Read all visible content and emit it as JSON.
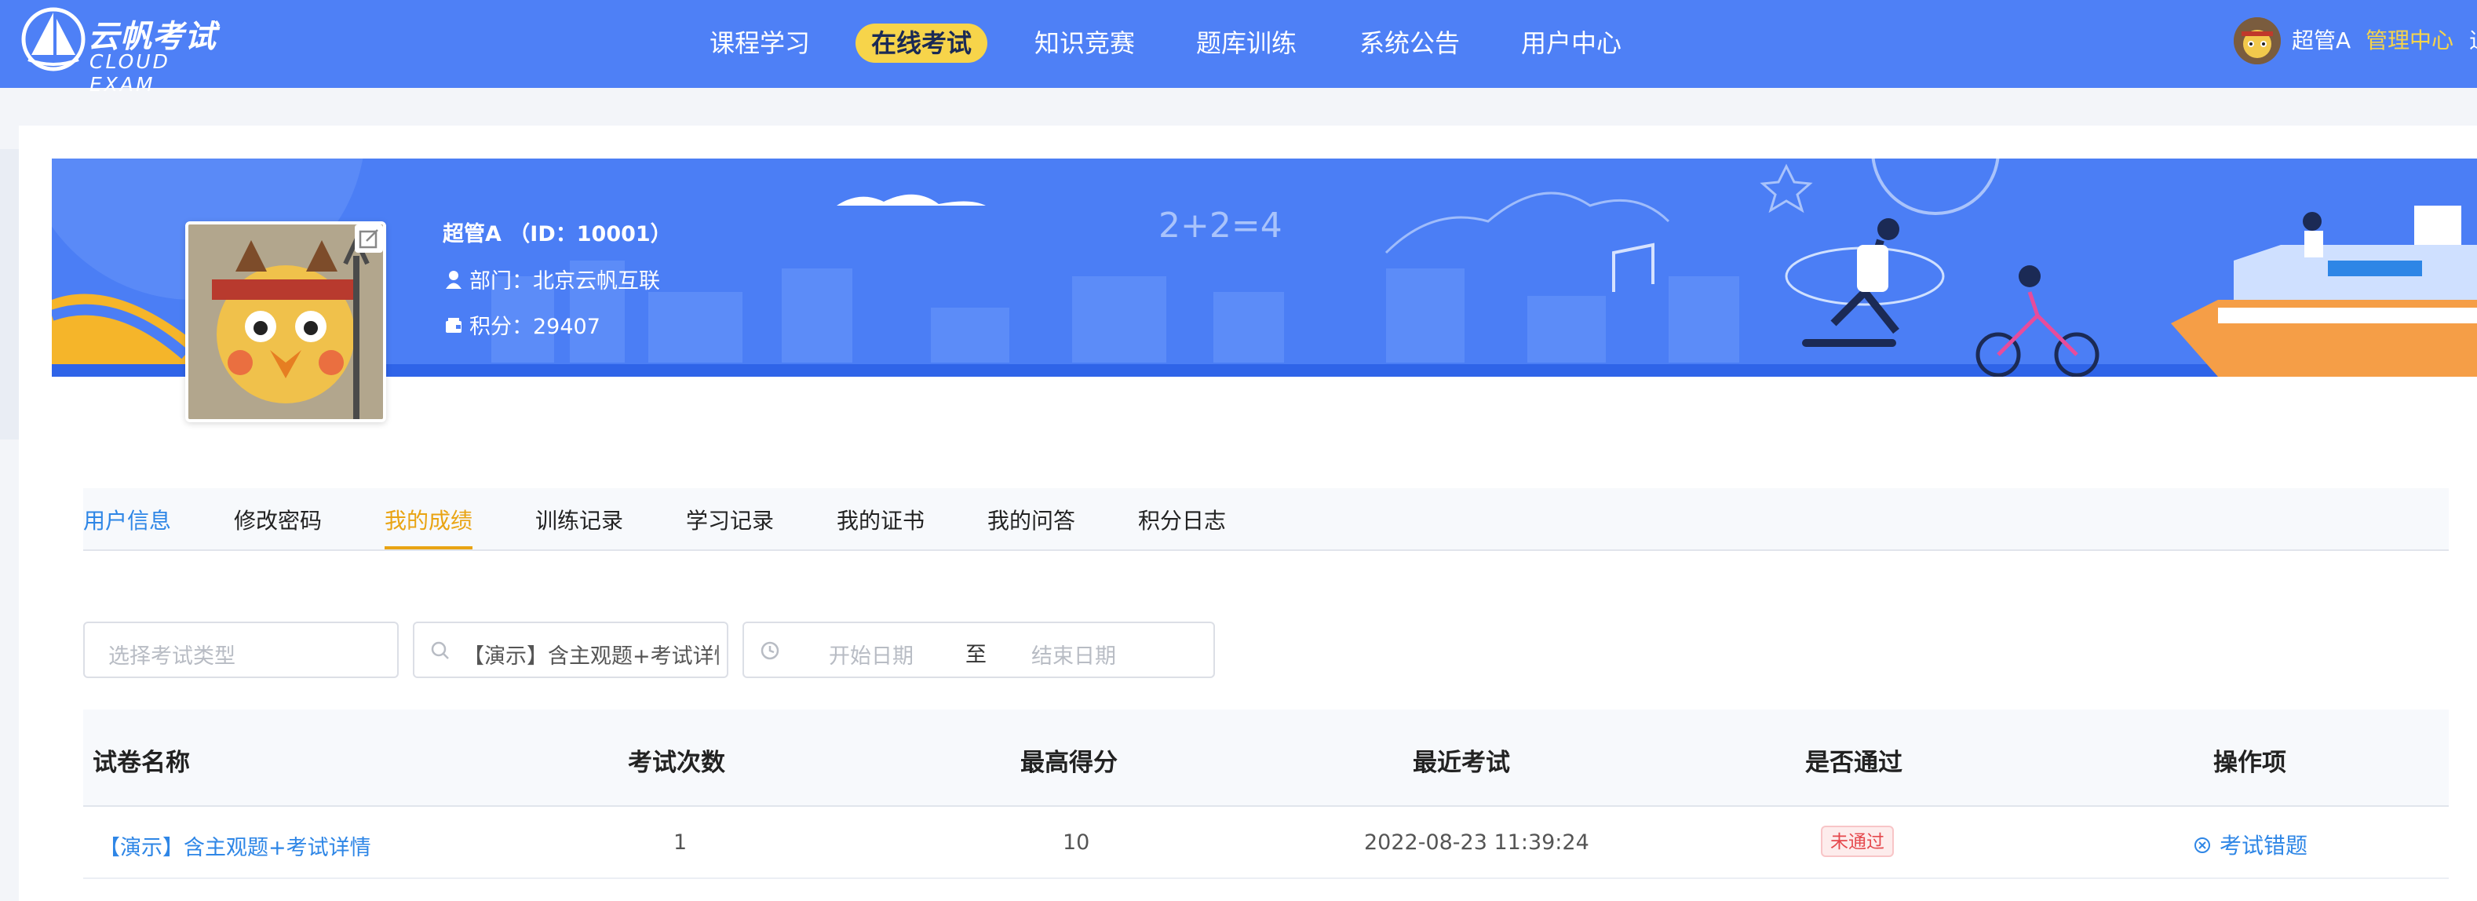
{
  "brand": {
    "name_cn": "云帆考试",
    "name_en": "CLOUD EXAM",
    "primary_color": "#4e80f6",
    "accent_color": "#f7d44a"
  },
  "nav": {
    "items": [
      {
        "label": "课程学习"
      },
      {
        "label": "在线考试"
      },
      {
        "label": "知识竞赛"
      },
      {
        "label": "题库训练"
      },
      {
        "label": "系统公告"
      },
      {
        "label": "用户中心"
      }
    ],
    "active_index": 1
  },
  "user": {
    "name": "超管A",
    "admin_label": "管理中心",
    "exit_label": "退"
  },
  "profile": {
    "name_line": "超管A （ID：10001）",
    "department": "部门：北京云帆互联",
    "points": "积分：29407"
  },
  "tabs": {
    "items": [
      {
        "label": "用户信息"
      },
      {
        "label": "修改密码"
      },
      {
        "label": "我的成绩"
      },
      {
        "label": "训练记录"
      },
      {
        "label": "学习记录"
      },
      {
        "label": "我的证书"
      },
      {
        "label": "我的问答"
      },
      {
        "label": "积分日志"
      }
    ],
    "active_index": 2
  },
  "filters": {
    "exam_type_placeholder": "选择考试类型",
    "search_value": "【演示】含主观题+考试详情",
    "start_placeholder": "开始日期",
    "range_separator": "至",
    "end_placeholder": "结束日期"
  },
  "table": {
    "headers": [
      "试卷名称",
      "考试次数",
      "最高得分",
      "最近考试",
      "是否通过",
      "操作项"
    ],
    "rows": [
      {
        "paper": "【演示】含主观题+考试详情",
        "attempts": "1",
        "max_score": "10",
        "last_exam": "2022-08-23 11:39:24",
        "passed": "未通过",
        "action": "考试错题"
      }
    ]
  },
  "icons": [
    "logo-sail-icon",
    "user-icon",
    "wallet-icon",
    "edit-icon",
    "search-icon",
    "clock-icon",
    "close-circle-icon"
  ],
  "status_colors": {
    "fail": "#e5484d",
    "link": "#2e86e6",
    "active_tab": "#e9a413"
  }
}
